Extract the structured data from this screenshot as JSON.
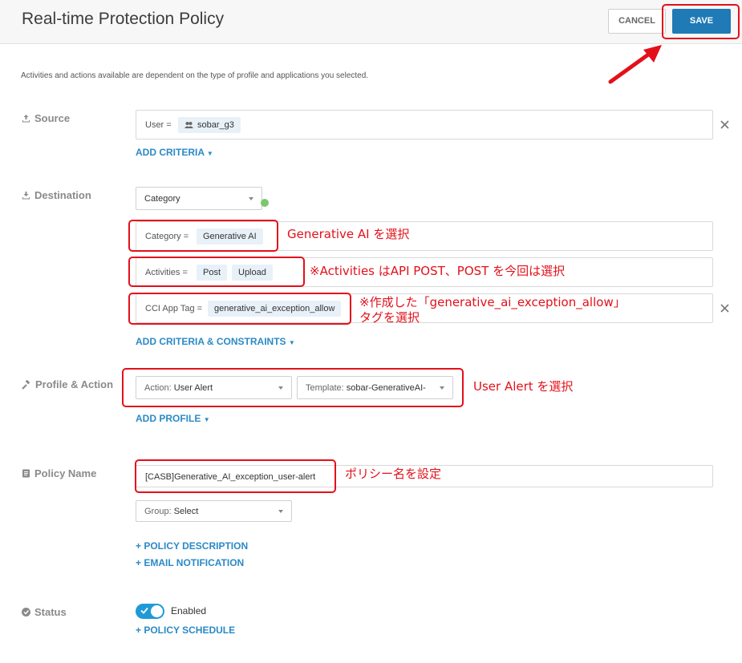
{
  "header": {
    "title": "Real-time Protection Policy",
    "cancel_label": "CANCEL",
    "save_label": "SAVE"
  },
  "subtitle": "Activities and actions available are dependent on the type of profile and applications you selected.",
  "source": {
    "label": "Source",
    "criteria_label": "User =",
    "criteria_value": "sobar_g3",
    "add_link": "ADD CRITERIA"
  },
  "destination": {
    "label": "Destination",
    "type_select": "Category",
    "category_label": "Category =",
    "category_value": "Generative AI",
    "activities_label": "Activities =",
    "activities_values": [
      "Post",
      "Upload"
    ],
    "tag_label": "CCI App Tag =",
    "tag_value": "generative_ai_exception_allow",
    "add_link": "ADD CRITERIA & CONSTRAINTS"
  },
  "profile_action": {
    "label": "Profile & Action",
    "action_prefix": "Action:",
    "action_value": "User Alert",
    "template_prefix": "Template:",
    "template_value": "sobar-GenerativeAI-",
    "add_link": "ADD PROFILE"
  },
  "policy_name": {
    "label": "Policy Name",
    "value": "[CASB]Generative_AI_exception_user-alert",
    "group_prefix": "Group:",
    "group_value": "Select",
    "description_link": "+ POLICY DESCRIPTION",
    "email_link": "+ EMAIL NOTIFICATION"
  },
  "status": {
    "label": "Status",
    "toggle_state": "Enabled",
    "schedule_link": "+ POLICY SCHEDULE"
  },
  "annotations": {
    "category": "Generative AI を選択",
    "activities": "※Activities はAPI POST、POST を今回は選択",
    "tag_line1": "※作成した「generative_ai_exception_allow」",
    "tag_line2": "タグを選択",
    "action": "User Alert を選択",
    "policy_name": "ポリシー名を設定"
  },
  "colors": {
    "accent": "#1f7ab6",
    "link": "#2a8ac6",
    "annotation": "#e3101a"
  }
}
